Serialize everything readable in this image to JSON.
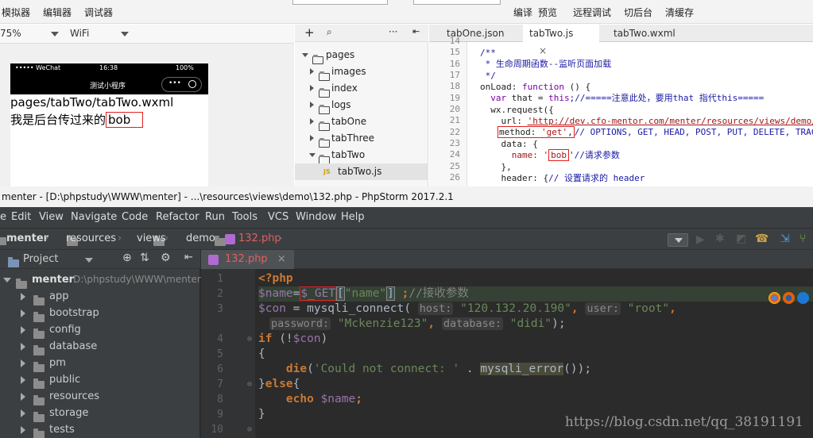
{
  "wechat": {
    "toolbar": {
      "simulator": "模拟器",
      "editor": "编辑器",
      "debugger": "调试器",
      "compile": "编译",
      "preview": "预览",
      "remote_debug": "远程调试",
      "background": "切后台",
      "clear_cache": "清缓存"
    },
    "device": {
      "zoom": "75%",
      "network": "WiFi"
    },
    "phone": {
      "carrier": "••••• WeChat",
      "time": "16:38",
      "battery": "100%",
      "nav_title": "测试小程序",
      "page_path": "pages/tabTwo/tabTwo.wxml",
      "content_prefix": "我是后台传过来的",
      "content_value": "bob"
    },
    "filetree": {
      "add": "+",
      "more": "···",
      "items": [
        {
          "label": "pages",
          "expanded": true,
          "level": 0
        },
        {
          "label": "images",
          "expanded": false,
          "level": 1
        },
        {
          "label": "index",
          "expanded": false,
          "level": 1
        },
        {
          "label": "logs",
          "expanded": false,
          "level": 1
        },
        {
          "label": "tabOne",
          "expanded": false,
          "level": 1
        },
        {
          "label": "tabThree",
          "expanded": false,
          "level": 1
        },
        {
          "label": "tabTwo",
          "expanded": true,
          "level": 1
        },
        {
          "label": "tabTwo.js",
          "file": "JS",
          "level": 2
        }
      ]
    },
    "editor": {
      "tabs": [
        {
          "label": "tabOne.json"
        },
        {
          "label": "tabTwo.js",
          "close": "×"
        },
        {
          "label": "tabTwo.wxml"
        }
      ],
      "line_numbers": [
        "14",
        "15",
        "16",
        "17",
        "18",
        "19",
        "20",
        "21",
        "22",
        "23",
        "24",
        "25",
        "26"
      ],
      "lines": {
        "l15": "/**",
        "l16": " * 生命周期函数--监听页面加载",
        "l17": " */",
        "l18a": "onLoad: ",
        "l18b": "function",
        "l18c": " () {",
        "l19a": "  var",
        "l19b": " that = ",
        "l19c": "this",
        "l19d": ";//=====注意此处，要用that 指代this=====",
        "l20": "  wx.request({",
        "l21a": "    url: ",
        "l21b": "'http://dev.cfo-mentor.com/menter/resources/views/demo/",
        "l22a": "method: ",
        "l22b": "'get'",
        "l22c": ",",
        "l22d": "// OPTIONS, GET, HEAD, POST, PUT, DELETE, TRAC",
        "l23": "    data: {",
        "l24a": "      name: '",
        "l24b": "bob",
        "l24c": "'//请求参数",
        "l25": "    },",
        "l26a": "    header: {",
        "l26b": "// 设置请求的 header"
      }
    }
  },
  "phpstorm": {
    "title": "menter - [D:\\phpstudy\\WWW\\menter] - ...\\resources\\views\\demo\\132.php - PhpStorm 2017.2.1",
    "menu": [
      "Edit",
      "View",
      "Navigate",
      "Code",
      "Refactor",
      "Run",
      "Tools",
      "VCS",
      "Window",
      "Help"
    ],
    "menu_first": "e",
    "breadcrumb": [
      "menter",
      "resources",
      "views",
      "demo",
      "132.php"
    ],
    "project": {
      "header": "Project",
      "root_name": "menter",
      "root_path": "D:\\phpstudy\\WWW\\menter",
      "folders": [
        "app",
        "bootstrap",
        "config",
        "database",
        "pm",
        "public",
        "resources",
        "storage",
        "tests"
      ]
    },
    "editor": {
      "tab": "132.php",
      "tab_close": "×",
      "line_numbers": [
        "1",
        "2",
        "3",
        "",
        "4",
        "5",
        "6",
        "7",
        "8",
        "9",
        "10"
      ],
      "code": {
        "l1": "<?php",
        "l2a": "$name",
        "l2b": "=",
        "l2c": "$_GET",
        "l2d": "[",
        "l2e": "\"name\"",
        "l2f": "]",
        "l2g": " ;",
        "l2h": "//接收参数",
        "l3a": "$con",
        "l3b": " = mysqli_connect( ",
        "l3h1": "host:",
        "l3s1": " \"120.132.20.190\"",
        "l3c": ", ",
        "l3h2": "user:",
        "l3s2": " \"root\"",
        "l3d": ",",
        "l3e_h": "password:",
        "l3e_s": " \"Mckenzie123\"",
        "l3f": ", ",
        "l3g_h": "database:",
        "l3g_s": " \"didi\"",
        "l3end": ");",
        "l4a": "if",
        "l4b": " (!",
        "l4c": "$con",
        "l4d": ")",
        "l5": "{",
        "l6a": "    die",
        "l6b": "(",
        "l6c": "'Could not connect: '",
        "l6d": " . ",
        "l6e": "mysqli_error",
        "l6f": "());",
        "l7a": "}",
        "l7b": "else",
        "l7c": "{",
        "l8a": "    echo",
        "l8b": " ",
        "l8c": "$name",
        "l8d": ";",
        "l9": "}"
      }
    },
    "watermark": "https://blog.csdn.net/qq_38191191"
  },
  "colors": {
    "red_box": "#e02020",
    "ps_bg": "#2b2b2b",
    "ps_panel": "#3c3f41"
  }
}
